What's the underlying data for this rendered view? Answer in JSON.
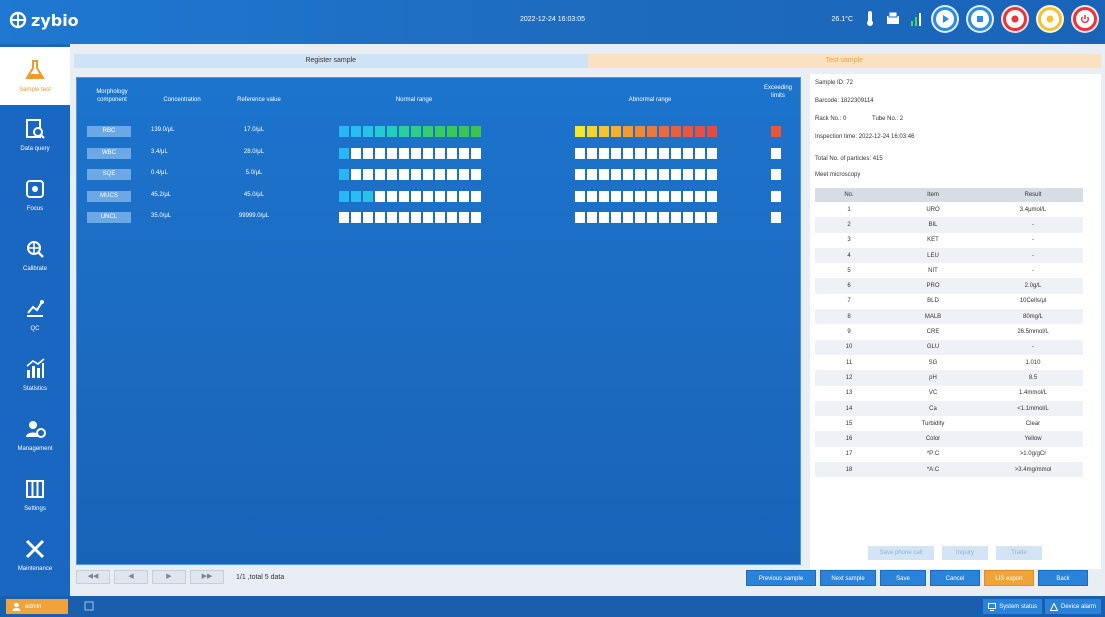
{
  "app": {
    "logo_text": "zybio",
    "datetime": "2022-12-24 16:03:05",
    "temperature": "26.1°C"
  },
  "colors": {
    "accent": "#f29a2e",
    "primary": "#1c74cc",
    "normal_green": "#30c85a",
    "abnormal_red": "#e8573a",
    "yellow": "#f4e22e"
  },
  "sidebar": {
    "items": [
      {
        "label": "Sample test",
        "icon": "flask-icon",
        "active": true
      },
      {
        "label": "Data query",
        "icon": "document-search-icon",
        "active": false
      },
      {
        "label": "Focus",
        "icon": "focus-target-icon",
        "active": false
      },
      {
        "label": "Calibrate",
        "icon": "calibrate-icon",
        "active": false
      },
      {
        "label": "QC",
        "icon": "qc-chart-icon",
        "active": false
      },
      {
        "label": "Statistics",
        "icon": "statistics-icon",
        "active": false
      },
      {
        "label": "Management",
        "icon": "user-management-icon",
        "active": false
      },
      {
        "label": "Settings",
        "icon": "settings-grid-icon",
        "active": false
      },
      {
        "label": "Maintenance",
        "icon": "tools-icon",
        "active": false
      }
    ]
  },
  "tabs": [
    "Register sample",
    "Test sample"
  ],
  "table": {
    "headers": [
      "Morphology component",
      "Concentration",
      "Reference value",
      "Normal range",
      "Abnormal range",
      "Exceeding limits"
    ],
    "rows": [
      {
        "name": "RBC",
        "conc": "139.0/μL",
        "ref": "17.0/μL",
        "normal_level": 12,
        "abnormal_level": 12,
        "exceed": true
      },
      {
        "name": "WBC",
        "conc": "3.4/μL",
        "ref": "28.0/μL",
        "normal_level": 1,
        "abnormal_level": 0,
        "exceed": false
      },
      {
        "name": "SQE",
        "conc": "0.4/μL",
        "ref": "5.0/μL",
        "normal_level": 1,
        "abnormal_level": 0,
        "exceed": false
      },
      {
        "name": "MUCS",
        "conc": "45.2/μL",
        "ref": "45.0/μL",
        "normal_level": 3,
        "abnormal_level": 0,
        "exceed": false
      },
      {
        "name": "UNCL",
        "conc": "35.0/μL",
        "ref": "99999.0/μL",
        "normal_level": 0,
        "abnormal_level": 0,
        "exceed": false
      }
    ]
  },
  "pager": {
    "text": "1/1 ,total 5 data"
  },
  "sample": {
    "sample_id": "Sample ID: 72",
    "barcode": "Barcode: 1822309114",
    "rack": "Rack No.: 0",
    "tube": "Tube No.: 2",
    "inspection_time": "Inspection time: 2022-12-24 16:03:46",
    "particles": "Total No. of particles: 415",
    "microscopy": "Meet microscopy"
  },
  "results": {
    "headers": [
      "No.",
      "Item",
      "Result"
    ],
    "rows": [
      [
        "1",
        "URO",
        "3.4μmol/L"
      ],
      [
        "2",
        "BIL",
        "-"
      ],
      [
        "3",
        "KET",
        "-"
      ],
      [
        "4",
        "LEU",
        "-"
      ],
      [
        "5",
        "NIT",
        "-"
      ],
      [
        "6",
        "PRO",
        "2.0g/L"
      ],
      [
        "7",
        "BLD",
        "10Cells/μl"
      ],
      [
        "8",
        "MALB",
        "80mg/L"
      ],
      [
        "9",
        "CRE",
        "26.5mmol/L"
      ],
      [
        "10",
        "GLU",
        "-"
      ],
      [
        "11",
        "SG",
        "1.010"
      ],
      [
        "12",
        "pH",
        "8.5"
      ],
      [
        "13",
        "VC",
        "1.4mmol/L"
      ],
      [
        "14",
        "Ca",
        "<1.1mmol/L"
      ],
      [
        "15",
        "Turbidity",
        "Clear"
      ],
      [
        "16",
        "Color",
        "Yellow"
      ],
      [
        "17",
        "*P:C",
        ">1.0g/gCr"
      ],
      [
        "18",
        "*A:C",
        ">3.4mg/mmol"
      ]
    ]
  },
  "right_buttons": [
    "Save phone call",
    "Inquiry",
    "Trade"
  ],
  "actions": [
    "Previous sample",
    "Next sample",
    "Save",
    "Cancel",
    "LIS export",
    "Back"
  ],
  "status": {
    "user": "admin",
    "system_status": "System status",
    "device_alarm": "Device alarm"
  }
}
